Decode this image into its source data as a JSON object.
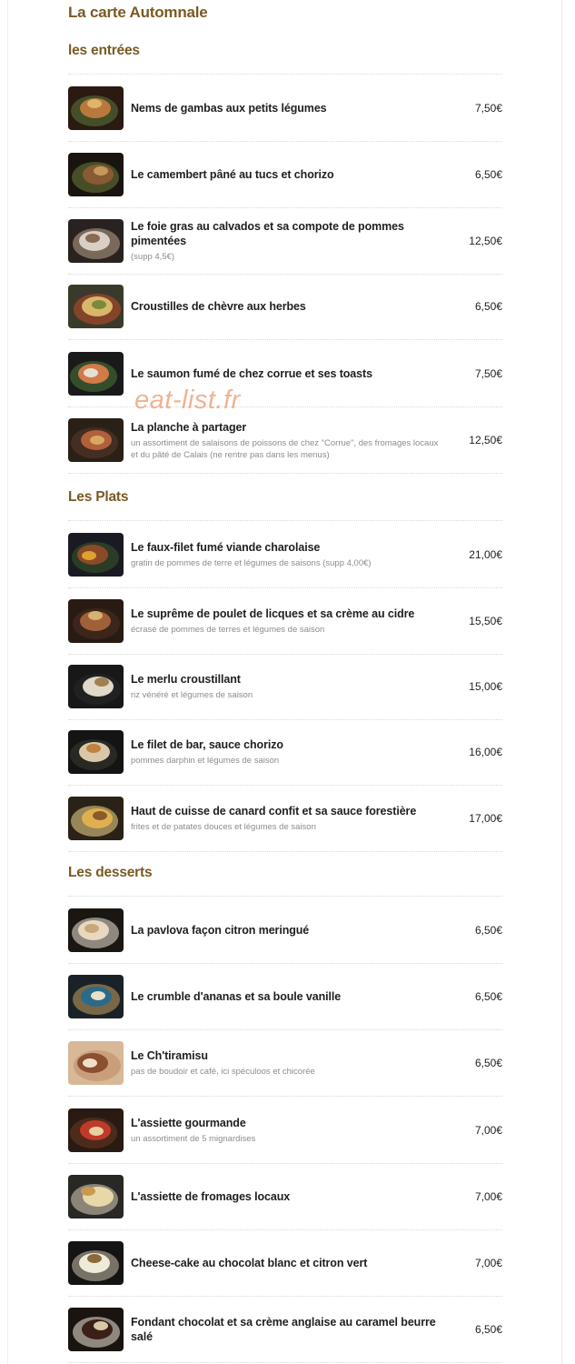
{
  "menu_title": "La carte Automnale",
  "watermark": "eat-list.fr",
  "sections": [
    {
      "title": "les entrées",
      "items": [
        {
          "name": "Nems de gambas aux petits légumes",
          "desc": "",
          "price": "7,50€",
          "palette": [
            "#2a1a12",
            "#b9793d",
            "#e1b46c",
            "#5a7a3a"
          ]
        },
        {
          "name": "Le camembert pâné au tucs et chorizo",
          "desc": "",
          "price": "6,50€",
          "palette": [
            "#1a1410",
            "#8a5a32",
            "#c49a5a",
            "#6e7e3a"
          ]
        },
        {
          "name": "Le foie gras au calvados et sa compote de pommes pimentées",
          "desc": "(supp 4,5€)",
          "price": "12,50€",
          "palette": [
            "#2a2220",
            "#d9cfc4",
            "#8a6a52",
            "#b8a48a"
          ]
        },
        {
          "name": "Croustilles de chèvre aux herbes",
          "desc": "",
          "price": "6,50€",
          "palette": [
            "#3a3a2a",
            "#d8b66a",
            "#7a8a3a",
            "#c24a2a"
          ]
        },
        {
          "name": "Le saumon fumé de chez corrue et ses toasts",
          "desc": "",
          "price": "7,50€",
          "palette": [
            "#1a1a1a",
            "#d27a4a",
            "#e6e0d0",
            "#4a7a3a"
          ]
        },
        {
          "name": "La planche à partager",
          "desc": "un assortiment de salaisons de poissons de chez \"Corrue\", des fromages locaux et du pâté de Calais (ne rentre pas dans les menus)",
          "price": "12,50€",
          "palette": [
            "#2a2018",
            "#b0603a",
            "#d8a860",
            "#5a3a2a"
          ]
        }
      ]
    },
    {
      "title": "Les Plats",
      "items": [
        {
          "name": "Le faux-filet fumé viande charolaise",
          "desc": "gratin de pommes de terre et légumes de saisons (supp 4,00€)",
          "price": "21,00€",
          "palette": [
            "#1a1a22",
            "#8a4a2a",
            "#e0a030",
            "#3a5a2a"
          ]
        },
        {
          "name": "Le suprême de poulet de licques et sa crème au cidre",
          "desc": "écrasé de pommes de terres et légumes de saison",
          "price": "15,50€",
          "palette": [
            "#2a1a14",
            "#a0603a",
            "#d8b070",
            "#4a3020"
          ]
        },
        {
          "name": "Le merlu croustillant",
          "desc": "riz vénéré et légumes de saison",
          "price": "15,00€",
          "palette": [
            "#181818",
            "#e0d8c8",
            "#a08050",
            "#2a2a2a"
          ]
        },
        {
          "name": "Le filet de bar, sauce chorizo",
          "desc": "pommes darphin et légumes de saison",
          "price": "16,00€",
          "palette": [
            "#141414",
            "#d8c8a8",
            "#c08040",
            "#3a3a30"
          ]
        },
        {
          "name": "Haut de cuisse de canard confit et sa sauce forestière",
          "desc": "frites et de patates douces et légumes de saison",
          "price": "17,00€",
          "palette": [
            "#2a2216",
            "#e0b050",
            "#8a5a2a",
            "#f0d890"
          ]
        }
      ]
    },
    {
      "title": "Les desserts",
      "items": [
        {
          "name": "La pavlova façon citron meringué",
          "desc": "",
          "price": "6,50€",
          "palette": [
            "#1a1612",
            "#e8d8c0",
            "#c8a878",
            "#f0e8d8"
          ]
        },
        {
          "name": "Le crumble d'ananas et sa boule vanille",
          "desc": "",
          "price": "6,50€",
          "palette": [
            "#1a2228",
            "#2a6a8a",
            "#e8e0c8",
            "#c8a060"
          ]
        },
        {
          "name": "Le Ch'tiramisu",
          "desc": "pas de boudoir et café, ici spéculoos et chicorée",
          "price": "6,50€",
          "palette": [
            "#d8b898",
            "#8a5030",
            "#f0e0c8",
            "#c08860"
          ]
        },
        {
          "name": "L'assiette gourmande",
          "desc": "un assortiment de 5 mignardises",
          "price": "7,00€",
          "palette": [
            "#2a1a14",
            "#c03a2a",
            "#e8d0a0",
            "#6a3a20"
          ]
        },
        {
          "name": "L'assiette de fromages locaux",
          "desc": "",
          "price": "7,00€",
          "palette": [
            "#2a2824",
            "#e8d8a8",
            "#c89a50",
            "#d8d0c0"
          ]
        },
        {
          "name": "Cheese-cake au chocolat blanc et citron vert",
          "desc": "",
          "price": "7,00€",
          "palette": [
            "#141414",
            "#f0ead8",
            "#8a6a3a",
            "#c8c0a8"
          ]
        },
        {
          "name": "Fondant chocolat et sa crème anglaise au caramel beurre salé",
          "desc": "",
          "price": "6,50€",
          "palette": [
            "#1a1410",
            "#3a2018",
            "#d8c8a8",
            "#f0e8d8"
          ]
        }
      ]
    }
  ]
}
